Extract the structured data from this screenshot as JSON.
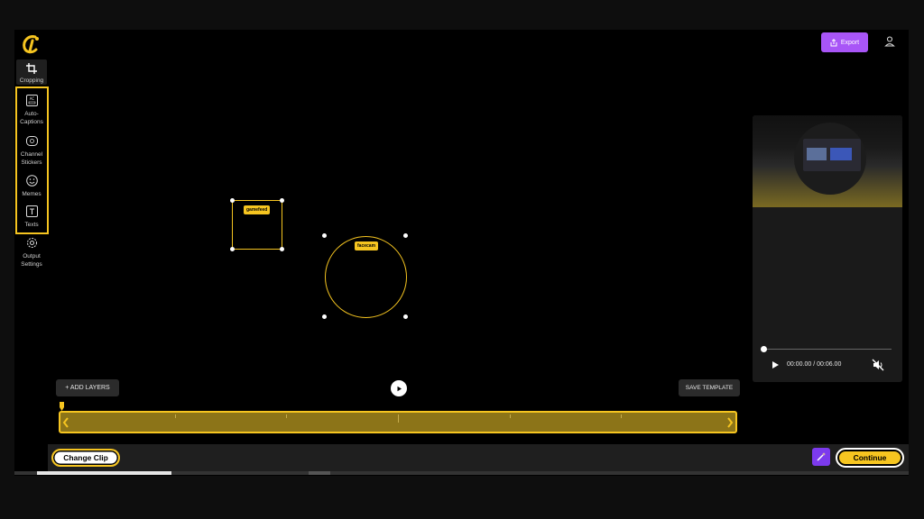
{
  "toolbar": {
    "items": [
      {
        "label": "Cropping",
        "icon": "crop-icon"
      },
      {
        "label": "Auto-Captions",
        "icon": "captions-icon"
      },
      {
        "label": "Channel Stickers",
        "icon": "sticker-icon"
      },
      {
        "label": "Memes",
        "icon": "meme-icon"
      },
      {
        "label": "Texts",
        "icon": "text-icon"
      },
      {
        "label": "Output Settings",
        "icon": "gear-icon"
      }
    ]
  },
  "header": {
    "export_label": "Export"
  },
  "canvas": {
    "gamefeed_tag": "gamefeed",
    "facecam_tag": "facecam"
  },
  "preview": {
    "time": "00:00.00 / 00:06.00",
    "progress": 0
  },
  "controls": {
    "add_layers_label": "+ ADD LAYERS",
    "save_template_label": "SAVE TEMPLATE"
  },
  "footer": {
    "change_clip_label": "Change Clip",
    "continue_label": "Continue"
  },
  "page_progress": 0.15,
  "colors": {
    "accent": "#f6c520",
    "export": "#a855f7",
    "magic": "#7c3aed",
    "background": "#000000"
  }
}
